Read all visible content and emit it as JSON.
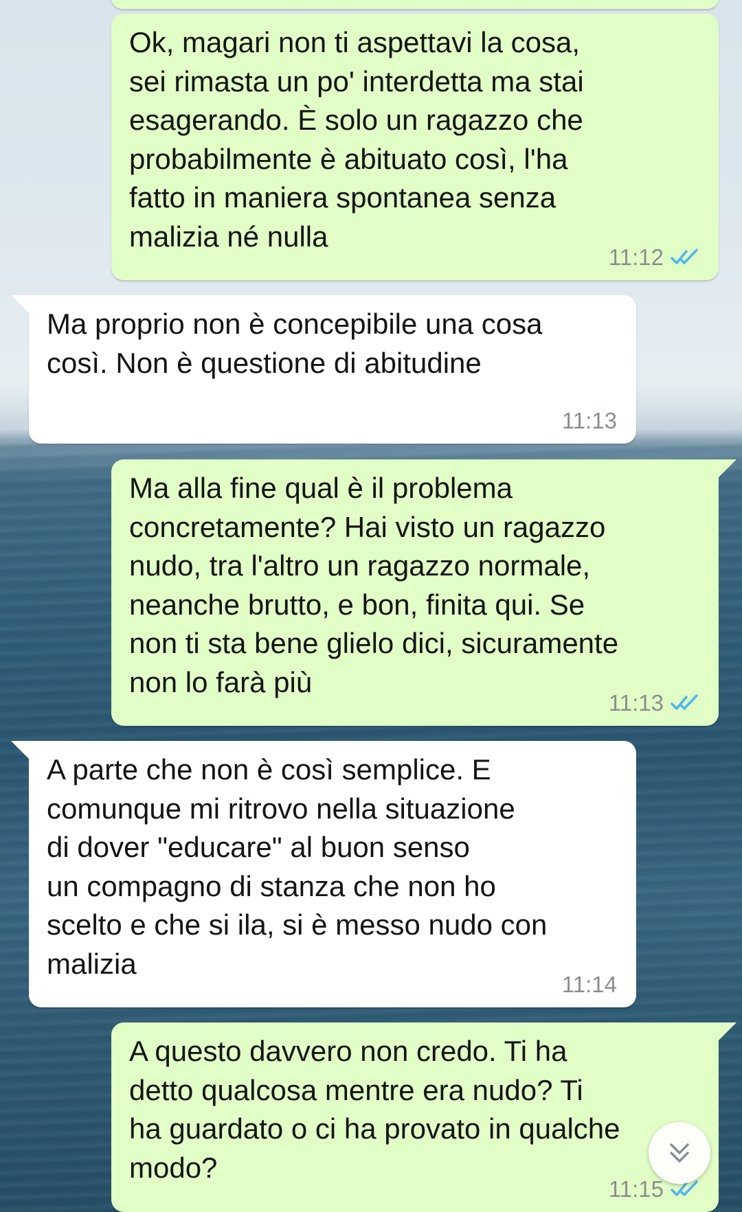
{
  "chat": {
    "messages": [
      {
        "direction": "outgoing",
        "text": "Ok, magari non ti aspettavi la cosa,\nsei rimasta un po' interdetta ma stai\nesagerando. È solo un ragazzo che\nprobabilmente è abituato così, l'ha\nfatto in maniera spontanea senza\nmalizia né nulla",
        "time": "11:12",
        "status": "read"
      },
      {
        "direction": "incoming",
        "text": "Ma proprio non è concepibile una cosa\ncosì. Non è questione di abitudine",
        "time": "11:13"
      },
      {
        "direction": "outgoing",
        "text": "Ma alla fine qual è il problema\nconcretamente? Hai visto un ragazzo\nnudo, tra l'altro un ragazzo normale,\nneanche brutto, e bon, finita qui. Se\nnon ti sta bene glielo dici, sicuramente\nnon lo farà più",
        "time": "11:13",
        "status": "read"
      },
      {
        "direction": "incoming",
        "text": "A parte che non è così semplice. E\ncomunque mi ritrovo nella situazione\ndi dover \"educare\" al buon senso\nun compagno di stanza che non ho\nscelto e che si ila, si è messo nudo con\nmalizia",
        "time": "11:14"
      },
      {
        "direction": "outgoing",
        "text": "A questo davvero non credo. Ti ha\ndetto qualcosa mentre era nudo? Ti\nha guardato o ci ha provato in qualche\nmodo?",
        "time": "11:15",
        "status": "read"
      }
    ]
  },
  "icons": {
    "read_receipt": "double-check-icon",
    "scroll_down": "double-chevron-down-icon"
  },
  "colors": {
    "outgoing_bubble": "#e1fec6",
    "incoming_bubble": "#ffffff",
    "read_ticks": "#4fb5ec",
    "timestamp": "#8a8f8a"
  }
}
